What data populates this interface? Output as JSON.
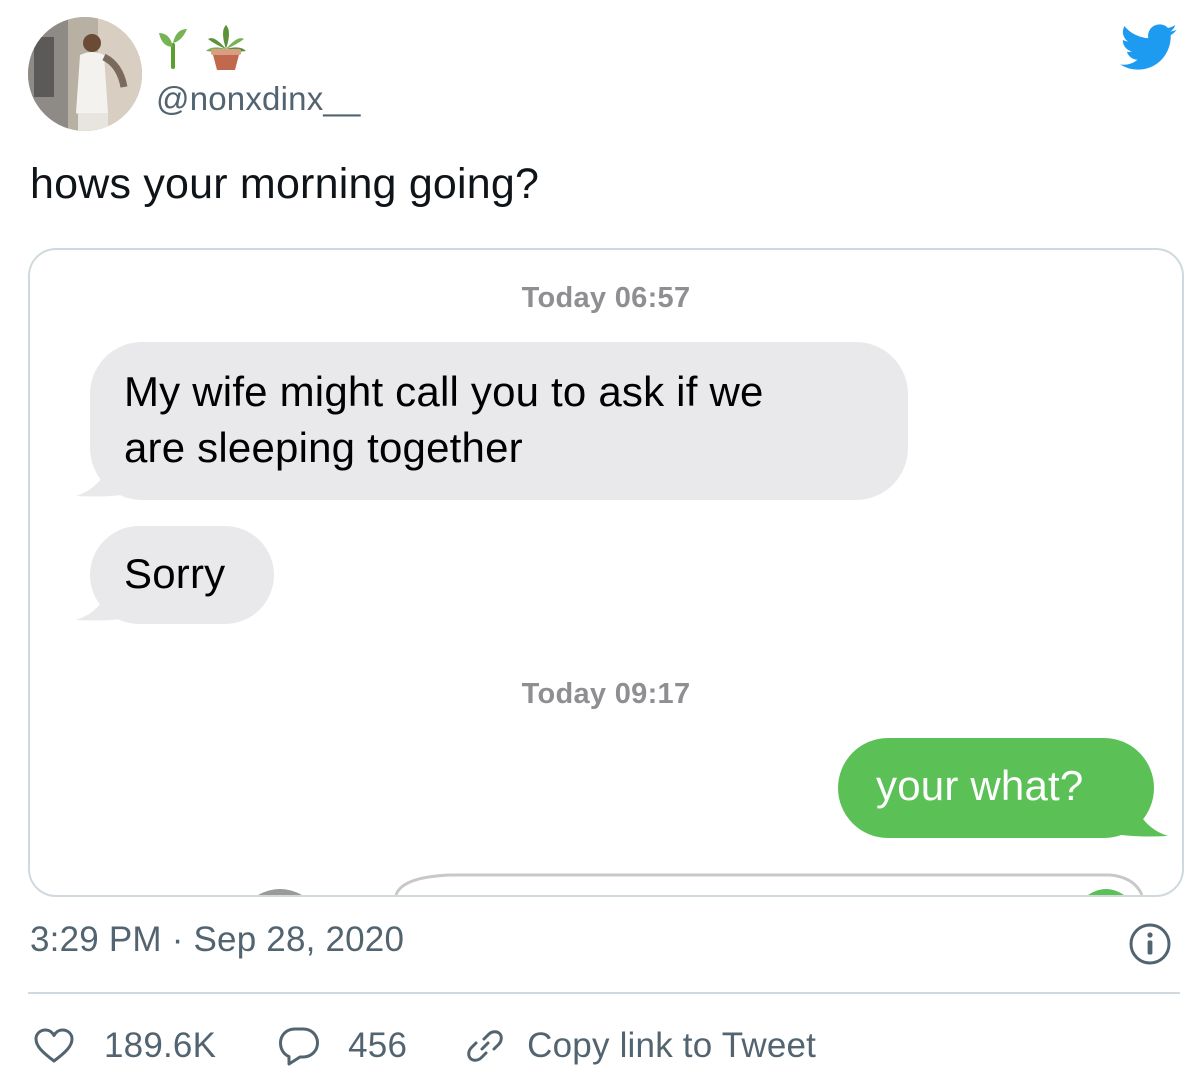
{
  "author": {
    "handle": "@nonxdinx__",
    "name_emojis": [
      "seedling-icon",
      "potted-plant-icon"
    ]
  },
  "tweet": {
    "text": "hows your morning going?"
  },
  "media": {
    "messages": [
      {
        "kind": "timestamp",
        "text": "Today 06:57"
      },
      {
        "kind": "received",
        "lines": [
          "My wife might call you to ask if we",
          "are sleeping together"
        ]
      },
      {
        "kind": "received",
        "lines": [
          "Sorry"
        ]
      },
      {
        "kind": "timestamp",
        "text": "Today 09:17"
      },
      {
        "kind": "sent",
        "lines": [
          "your what?"
        ]
      }
    ],
    "colors": {
      "received_bubble": "#e9e9eb",
      "sent_bubble": "#5bc157",
      "timestamp_text": "#8e8e93"
    }
  },
  "meta": {
    "time": "3:29 PM",
    "separator": "·",
    "date": "Sep 28, 2020"
  },
  "actions": {
    "likes": "189.6K",
    "replies": "456",
    "copy_link": "Copy link to Tweet"
  },
  "colors": {
    "brand": "#1d9bf0",
    "secondary_text": "#536471",
    "primary_text": "#0f1419",
    "border": "#cfd9de"
  }
}
